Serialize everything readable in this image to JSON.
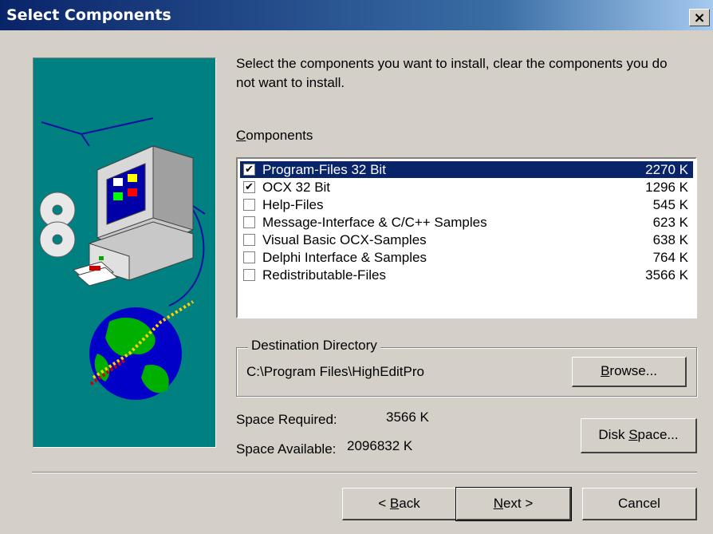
{
  "window": {
    "title": "Select Components",
    "close_glyph": "×"
  },
  "instructions": "Select the components you want to install, clear the components you do not want to install.",
  "components_label": {
    "mnemonic": "C",
    "rest": "omponents"
  },
  "components": [
    {
      "label": "Program-Files 32 Bit",
      "size": "2270 K",
      "checked": true,
      "selected": true
    },
    {
      "label": "OCX 32 Bit",
      "size": "1296 K",
      "checked": true,
      "selected": false
    },
    {
      "label": "Help-Files",
      "size": "545 K",
      "checked": false,
      "selected": false
    },
    {
      "label": "Message-Interface & C/C++ Samples",
      "size": "623 K",
      "checked": false,
      "selected": false
    },
    {
      "label": "Visual Basic OCX-Samples",
      "size": "638 K",
      "checked": false,
      "selected": false
    },
    {
      "label": "Delphi Interface & Samples",
      "size": "764 K",
      "checked": false,
      "selected": false
    },
    {
      "label": "Redistributable-Files",
      "size": "3566 K",
      "checked": false,
      "selected": false
    }
  ],
  "checkmark_glyph": "✔",
  "destination": {
    "legend": "Destination Directory",
    "path": "C:\\Program Files\\HighEditPro",
    "browse": {
      "mnemonic": "B",
      "rest": "rowse..."
    }
  },
  "space": {
    "required_label": "Space Required:",
    "required_value": "3566 K",
    "available_label": "Space Available:",
    "available_value": "2096832 K"
  },
  "disk_space_button": {
    "before": "Disk ",
    "mnemonic": "S",
    "after": "pace..."
  },
  "buttons": {
    "back": {
      "before": "< ",
      "mnemonic": "B",
      "after": "ack"
    },
    "next": {
      "mnemonic": "N",
      "after": "ext >"
    },
    "cancel": "Cancel"
  },
  "colors": {
    "titlebar": "#0a246a",
    "selection": "#0a246a",
    "dialog": "#d4d0c8",
    "illustration_bg": "#008080"
  }
}
